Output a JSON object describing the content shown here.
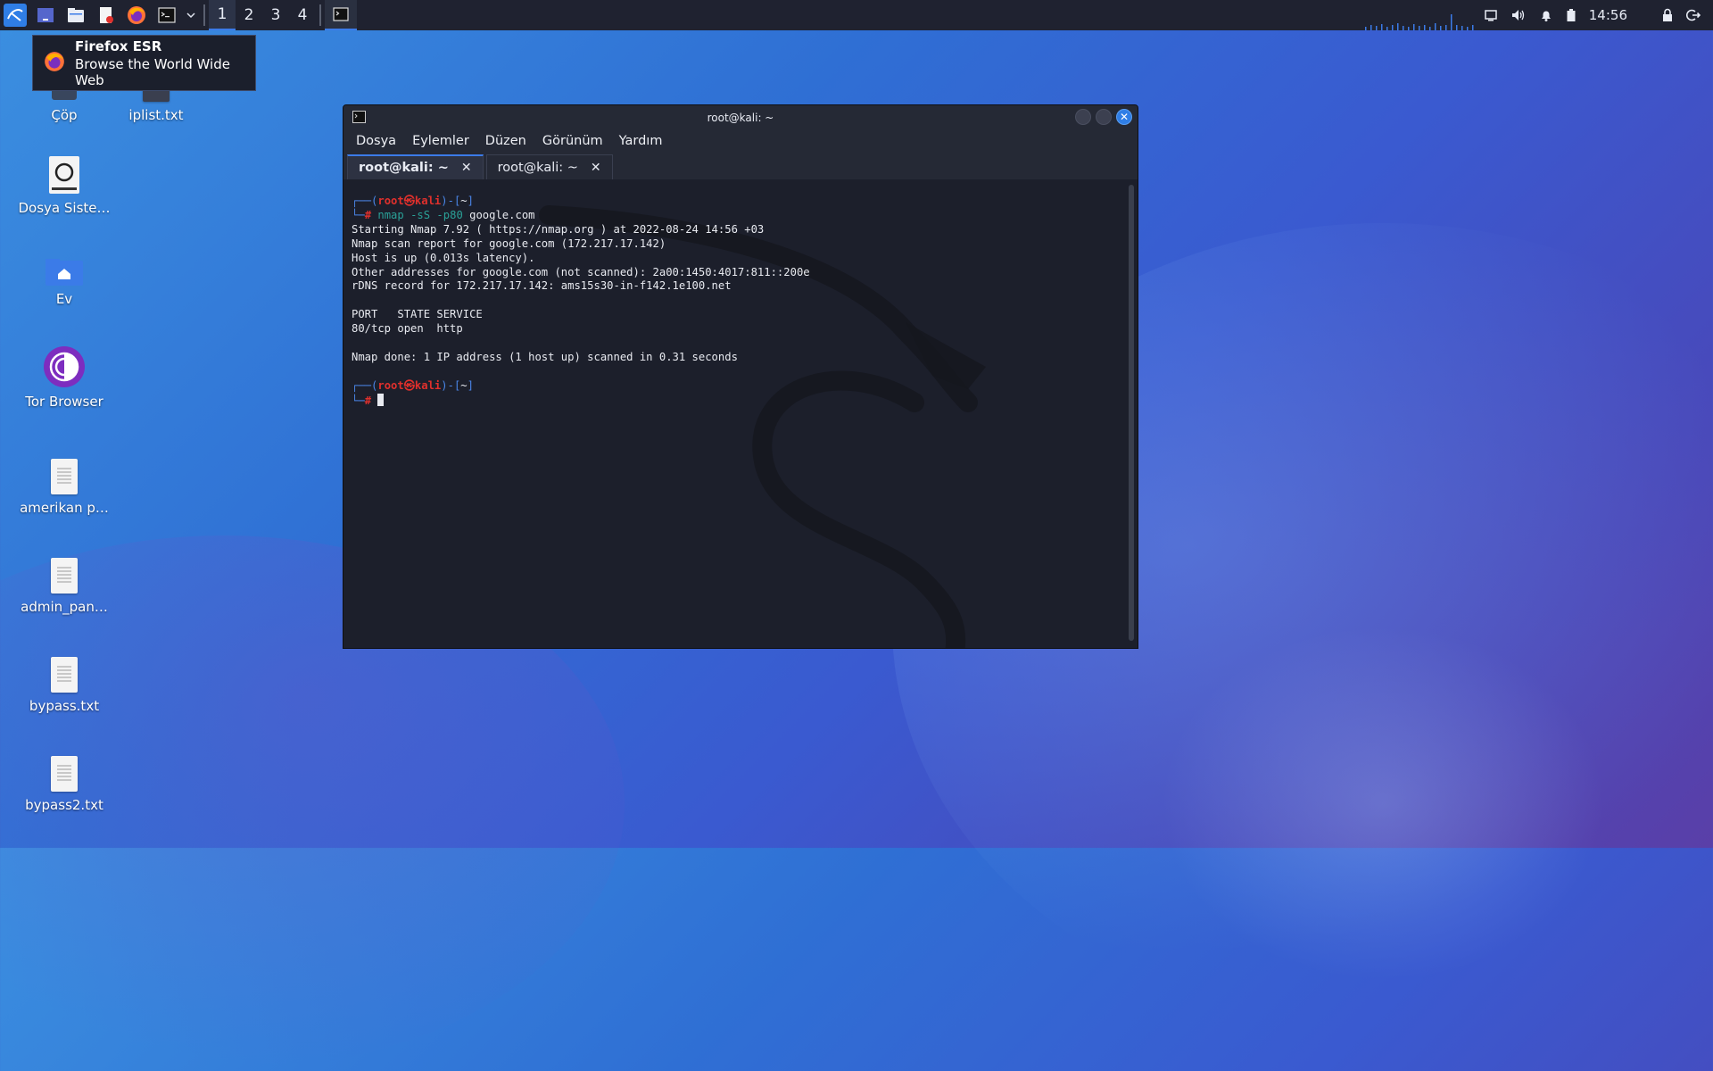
{
  "taskbar": {
    "workspaces": [
      "1",
      "2",
      "3",
      "4"
    ],
    "active_workspace": "1",
    "clock": "14:56"
  },
  "tooltip": {
    "title": "Firefox ESR",
    "subtitle": "Browse the World Wide Web"
  },
  "desktop": {
    "icons": [
      {
        "label": "Çöp",
        "icon": "trash-icon"
      },
      {
        "label": "iplist.txt",
        "icon": "text-file-icon"
      },
      {
        "label": "Dosya Siste…",
        "icon": "drive-icon"
      },
      {
        "label": "Ev",
        "icon": "home-folder-icon"
      },
      {
        "label": "Tor Browser",
        "icon": "tor-browser-icon"
      },
      {
        "label": "amerikan p…",
        "icon": "text-file-icon"
      },
      {
        "label": "admin_pan…",
        "icon": "text-file-icon"
      },
      {
        "label": "bypass.txt",
        "icon": "text-file-icon"
      },
      {
        "label": "bypass2.txt",
        "icon": "text-file-icon"
      }
    ]
  },
  "terminal": {
    "title": "root@kali: ~",
    "menu": [
      "Dosya",
      "Eylemler",
      "Düzen",
      "Görünüm",
      "Yardım"
    ],
    "tabs": [
      {
        "label": "root@kali: ~",
        "active": true
      },
      {
        "label": "root@kali: ~",
        "active": false
      }
    ],
    "prompt": {
      "user": "root",
      "at": "㉿",
      "host": "kali",
      "dir": "~"
    },
    "command": {
      "cmd": "nmap",
      "flags": "-sS -p80",
      "arg": "google.com"
    },
    "output": [
      "Starting Nmap 7.92 ( https://nmap.org ) at 2022-08-24 14:56 +03",
      "Nmap scan report for google.com (172.217.17.142)",
      "Host is up (0.013s latency).",
      "Other addresses for google.com (not scanned): 2a00:1450:4017:811::200e",
      "rDNS record for 172.217.17.142: ams15s30-in-f142.1e100.net",
      "",
      "PORT   STATE SERVICE",
      "80/tcp open  http",
      "",
      "Nmap done: 1 IP address (1 host up) scanned in 0.31 seconds"
    ]
  },
  "colors": {
    "accent": "#3b7be8",
    "prompt_red": "#e0302c",
    "prompt_blue": "#4a86e8",
    "command_cyan": "#2aa198"
  }
}
